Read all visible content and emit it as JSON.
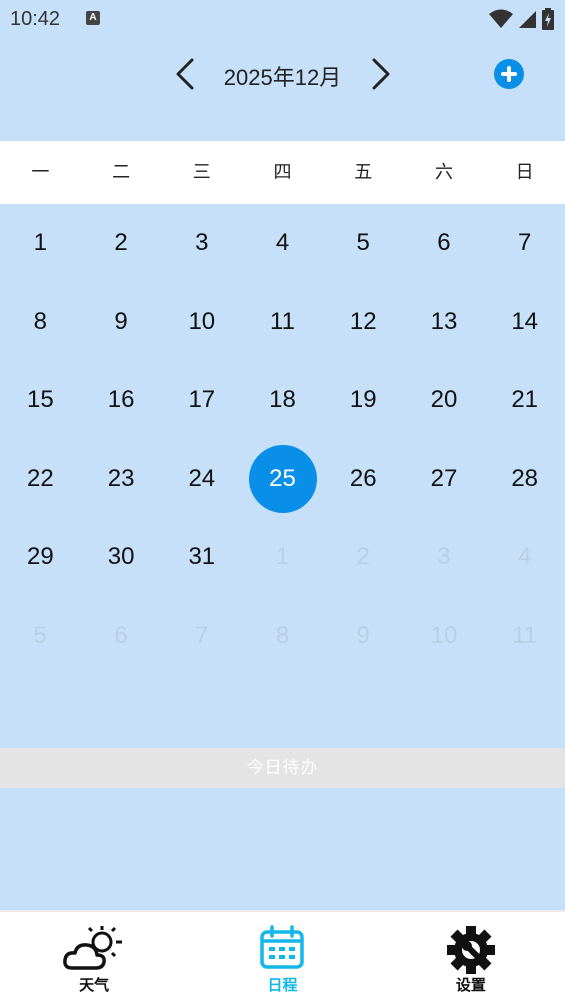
{
  "status": {
    "time": "10:42",
    "a_badge": "A"
  },
  "header": {
    "month_title": "2025年12月"
  },
  "weekdays": [
    "一",
    "二",
    "三",
    "四",
    "五",
    "六",
    "日"
  ],
  "calendar": {
    "weeks": [
      [
        {
          "d": "1"
        },
        {
          "d": "2"
        },
        {
          "d": "3"
        },
        {
          "d": "4"
        },
        {
          "d": "5"
        },
        {
          "d": "6"
        },
        {
          "d": "7"
        }
      ],
      [
        {
          "d": "8"
        },
        {
          "d": "9"
        },
        {
          "d": "10"
        },
        {
          "d": "11"
        },
        {
          "d": "12"
        },
        {
          "d": "13"
        },
        {
          "d": "14"
        }
      ],
      [
        {
          "d": "15"
        },
        {
          "d": "16"
        },
        {
          "d": "17"
        },
        {
          "d": "18"
        },
        {
          "d": "19"
        },
        {
          "d": "20"
        },
        {
          "d": "21"
        }
      ],
      [
        {
          "d": "22"
        },
        {
          "d": "23"
        },
        {
          "d": "24"
        },
        {
          "d": "25",
          "today": true
        },
        {
          "d": "26"
        },
        {
          "d": "27"
        },
        {
          "d": "28"
        }
      ],
      [
        {
          "d": "29"
        },
        {
          "d": "30"
        },
        {
          "d": "31"
        },
        {
          "d": "1",
          "other": true
        },
        {
          "d": "2",
          "other": true
        },
        {
          "d": "3",
          "other": true
        },
        {
          "d": "4",
          "other": true
        }
      ],
      [
        {
          "d": "5",
          "other": true
        },
        {
          "d": "6",
          "other": true
        },
        {
          "d": "7",
          "other": true
        },
        {
          "d": "8",
          "other": true
        },
        {
          "d": "9",
          "other": true
        },
        {
          "d": "10",
          "other": true
        },
        {
          "d": "11",
          "other": true
        }
      ]
    ]
  },
  "todo": {
    "label": "今日待办"
  },
  "nav": {
    "items": [
      {
        "label": "天气",
        "icon": "weather-icon",
        "active": false
      },
      {
        "label": "日程",
        "icon": "calendar-icon",
        "active": true
      },
      {
        "label": "设置",
        "icon": "settings-icon",
        "active": false
      }
    ]
  },
  "colors": {
    "background": "#c5e0f8",
    "accent": "#0a8fe8",
    "active_tab": "#13b7e8"
  }
}
